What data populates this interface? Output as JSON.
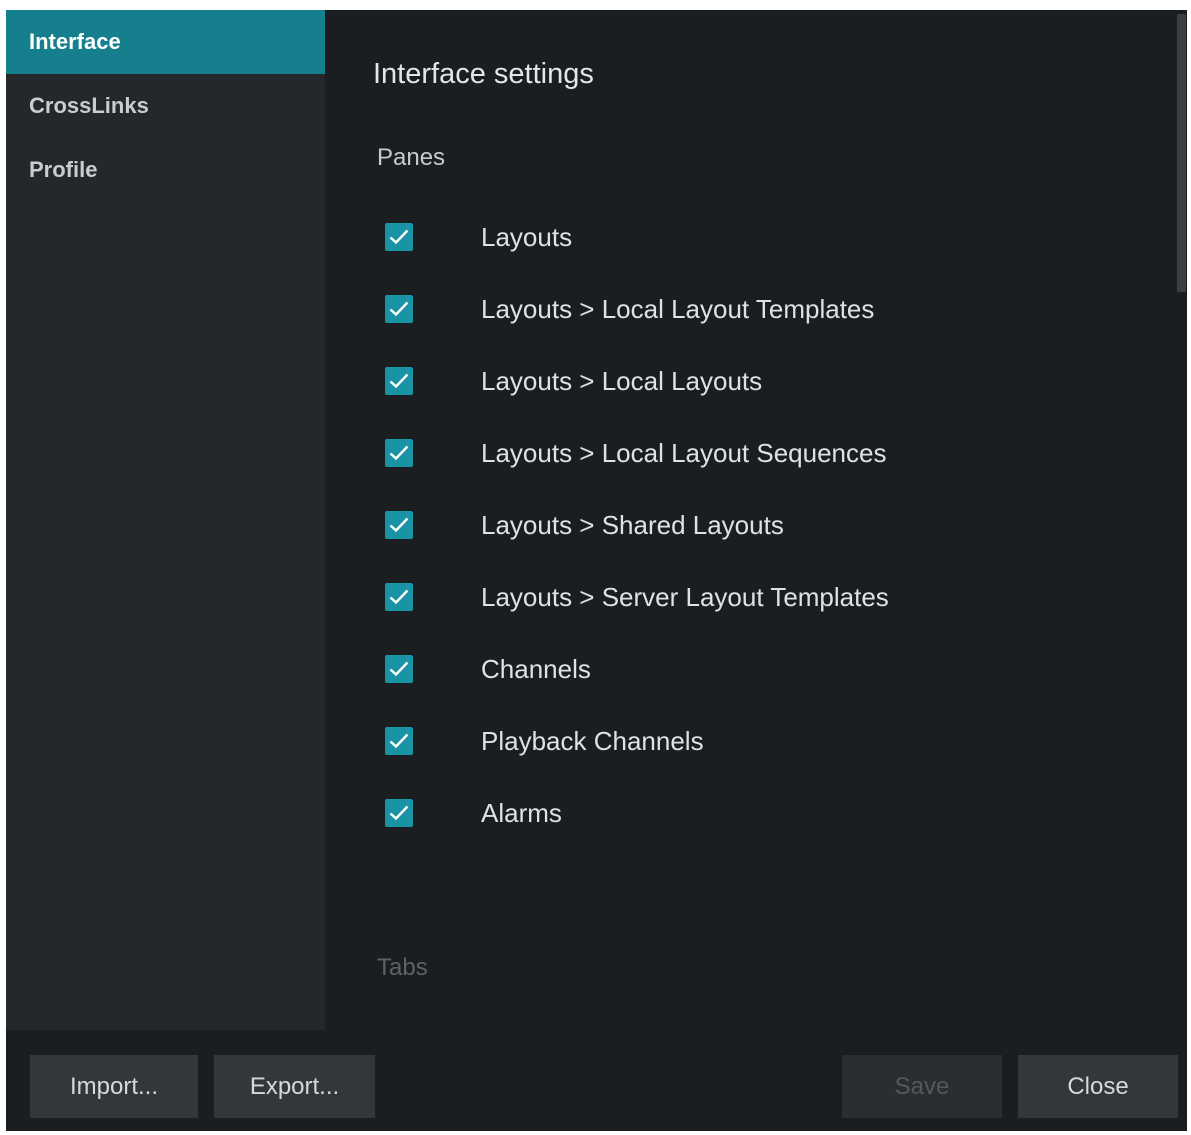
{
  "sidebar": {
    "items": [
      {
        "label": "Interface",
        "active": true
      },
      {
        "label": "CrossLinks",
        "active": false
      },
      {
        "label": "Profile",
        "active": false
      }
    ]
  },
  "main": {
    "title": "Interface settings",
    "panes_heading": "Panes",
    "panes": [
      {
        "label": "Layouts",
        "checked": true
      },
      {
        "label": "Layouts > Local Layout Templates",
        "checked": true
      },
      {
        "label": "Layouts > Local Layouts",
        "checked": true
      },
      {
        "label": "Layouts > Local Layout Sequences",
        "checked": true
      },
      {
        "label": "Layouts > Shared Layouts",
        "checked": true
      },
      {
        "label": "Layouts > Server Layout Templates",
        "checked": true
      },
      {
        "label": "Channels",
        "checked": true
      },
      {
        "label": "Playback Channels",
        "checked": true
      },
      {
        "label": "Alarms",
        "checked": true
      }
    ],
    "tabs_heading": "Tabs"
  },
  "footer": {
    "import_label": "Import...",
    "export_label": "Export...",
    "save_label": "Save",
    "save_enabled": false,
    "close_label": "Close"
  },
  "colors": {
    "accent": "#157f8e",
    "checkbox": "#1a93a5",
    "background": "#1b1e21",
    "sidebar": "#25282b"
  },
  "icons": {
    "checkbox": "checkmark-icon"
  }
}
